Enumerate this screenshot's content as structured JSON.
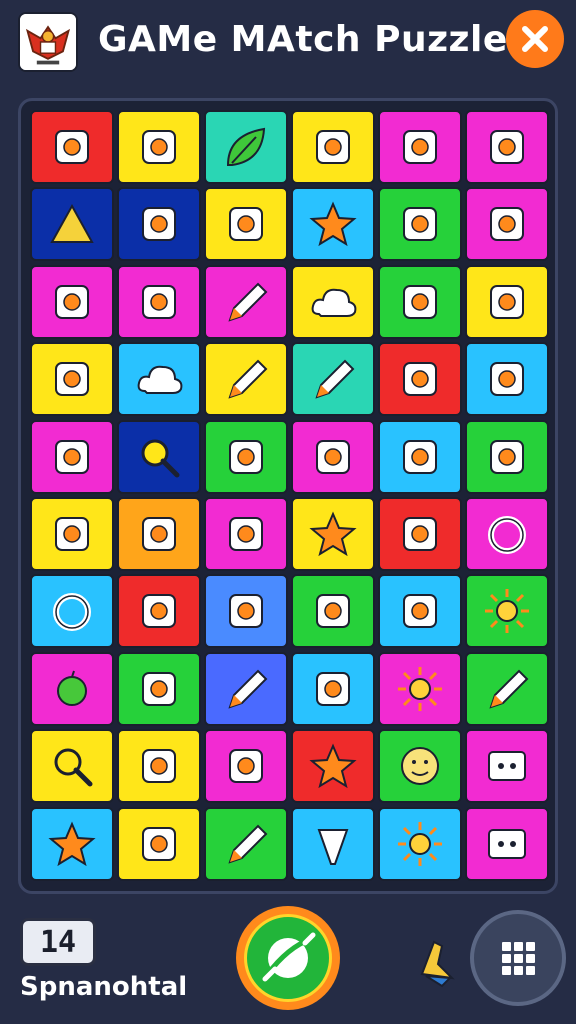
{
  "header": {
    "title": "GAMe MAtch Puzzle",
    "logo_icon": "garuda-emblem-icon",
    "close_icon": "close-icon"
  },
  "board": {
    "rows": [
      [
        {
          "bg": "#ef2b2b",
          "icon": "eagle-emblem-icon"
        },
        {
          "bg": "#ffe619",
          "icon": "boy-face-icon"
        },
        {
          "bg": "#2ad6b4",
          "icon": "leaf-icon"
        },
        {
          "bg": "#ffe619",
          "icon": "hand-icon"
        },
        {
          "bg": "#f22bd2",
          "icon": "winged-crest-icon"
        },
        {
          "bg": "#f22bd2",
          "icon": "eagle-crest-icon"
        }
      ],
      [
        {
          "bg": "#0b2fa8",
          "icon": "triangle-icon"
        },
        {
          "bg": "#0b2fa8",
          "icon": "bird-icon"
        },
        {
          "bg": "#ffe619",
          "icon": "box-heart-icon"
        },
        {
          "bg": "#29c2ff",
          "icon": "star-icon"
        },
        {
          "bg": "#26d13a",
          "icon": "card-icon"
        },
        {
          "bg": "#f22bd2",
          "icon": "envelope-icon"
        }
      ],
      [
        {
          "bg": "#f22bd2",
          "icon": "sofa-icon"
        },
        {
          "bg": "#f22bd2",
          "icon": "rocket-icon"
        },
        {
          "bg": "#f22bd2",
          "icon": "pen-icon"
        },
        {
          "bg": "#ffe619",
          "icon": "cloud-icon"
        },
        {
          "bg": "#26d13a",
          "icon": "drum-icon"
        },
        {
          "bg": "#ffe619",
          "icon": "document-icon"
        }
      ],
      [
        {
          "bg": "#ffe619",
          "icon": "cheese-icon"
        },
        {
          "bg": "#29c2ff",
          "icon": "cloud-icon"
        },
        {
          "bg": "#ffe619",
          "icon": "pencil-icon"
        },
        {
          "bg": "#2ad6b4",
          "icon": "hammer-icon"
        },
        {
          "bg": "#ef2b2b",
          "icon": "snake-icon"
        },
        {
          "bg": "#29c2ff",
          "icon": "robot-icon"
        }
      ],
      [
        {
          "bg": "#f22bd2",
          "icon": "ribbon-icon"
        },
        {
          "bg": "#0b2fa8",
          "icon": "magnifier-icon"
        },
        {
          "bg": "#26d13a",
          "icon": "cup-icon"
        },
        {
          "bg": "#f22bd2",
          "icon": "flag-icon"
        },
        {
          "bg": "#29c2ff",
          "icon": "button-icon"
        },
        {
          "bg": "#26d13a",
          "icon": "glove-icon"
        }
      ],
      [
        {
          "bg": "#ffe619",
          "icon": "medal-icon"
        },
        {
          "bg": "#ffa51a",
          "icon": "fish-icon"
        },
        {
          "bg": "#f22bd2",
          "icon": "chat-icon"
        },
        {
          "bg": "#ffe619",
          "icon": "star-icon"
        },
        {
          "bg": "#ef2b2b",
          "icon": "gamepad-icon"
        },
        {
          "bg": "#f22bd2",
          "icon": "ring-icon"
        }
      ],
      [
        {
          "bg": "#29c2ff",
          "icon": "ring-icon"
        },
        {
          "bg": "#ef2b2b",
          "icon": "binoculars-icon"
        },
        {
          "bg": "#4a8bff",
          "icon": "ladybug-icon"
        },
        {
          "bg": "#26d13a",
          "icon": "shield-icon"
        },
        {
          "bg": "#29c2ff",
          "icon": "paddle-icon"
        },
        {
          "bg": "#26d13a",
          "icon": "gear-icon"
        }
      ],
      [
        {
          "bg": "#f22bd2",
          "icon": "apple-icon"
        },
        {
          "bg": "#26d13a",
          "icon": "cookie-icon"
        },
        {
          "bg": "#4a6aff",
          "icon": "wrench-icon"
        },
        {
          "bg": "#29c2ff",
          "icon": "calculator-icon"
        },
        {
          "bg": "#f22bd2",
          "icon": "sun-icon"
        },
        {
          "bg": "#26d13a",
          "icon": "marker-icon"
        }
      ],
      [
        {
          "bg": "#ffe619",
          "icon": "magnifier-icon"
        },
        {
          "bg": "#ffe619",
          "icon": "cannon-icon"
        },
        {
          "bg": "#f22bd2",
          "icon": "bug-icon"
        },
        {
          "bg": "#ef2b2b",
          "icon": "star-icon"
        },
        {
          "bg": "#26d13a",
          "icon": "smiley-icon"
        },
        {
          "bg": "#f22bd2",
          "icon": "tv-icon"
        }
      ],
      [
        {
          "bg": "#29c2ff",
          "icon": "star-icon"
        },
        {
          "bg": "#ffe619",
          "icon": "controller-icon"
        },
        {
          "bg": "#26d13a",
          "icon": "pen-icon"
        },
        {
          "bg": "#29c2ff",
          "icon": "cone-icon"
        },
        {
          "bg": "#29c2ff",
          "icon": "sunflower-icon"
        },
        {
          "bg": "#f22bd2",
          "icon": "tv-icon"
        }
      ]
    ]
  },
  "footer": {
    "counter_value": "14",
    "counter_label": "Spnanohtal",
    "play_icon": "planet-icon",
    "hint_icon": "bell-icon",
    "menu_icon": "grid-menu-icon"
  },
  "colors": {
    "background": "#252c45",
    "accent_orange": "#ff7a1a",
    "play_green": "#22b53a"
  }
}
